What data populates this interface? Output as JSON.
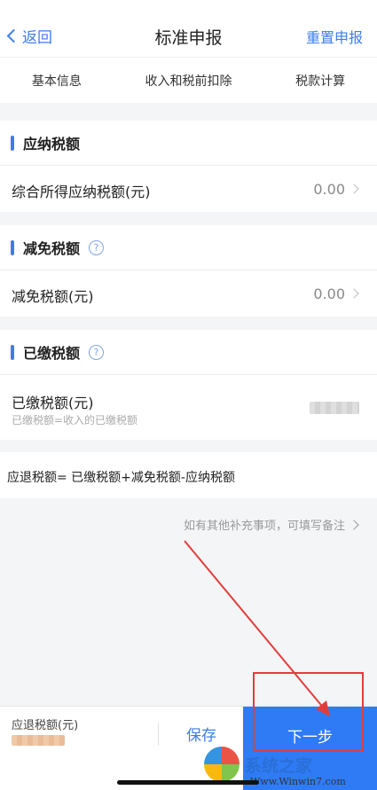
{
  "nav": {
    "back_label": "返回",
    "title": "标准申报",
    "reset_label": "重置申报"
  },
  "tabs": [
    "基本信息",
    "收入和税前扣除",
    "税款计算"
  ],
  "sections": {
    "payable": {
      "title": "应纳税额",
      "row_label": "综合所得应纳税额(元)",
      "row_value": "0.00"
    },
    "reduction": {
      "title": "减免税额",
      "row_label": "减免税额(元)",
      "row_value": "0.00"
    },
    "paid": {
      "title": "已缴税额",
      "row_label": "已缴税额(元)",
      "row_sub": "已缴税额=收入的已缴税额"
    }
  },
  "formula": "应退税额= 已缴税额+减免税额-应纳税额",
  "note": "如有其他补充事项，可填写备注",
  "footer": {
    "refund_label": "应退税额(元)",
    "save_label": "保存",
    "next_label": "下一步"
  },
  "watermark": {
    "brand": "系统之家",
    "url": "Www.Winwin7.com"
  },
  "colors": {
    "accent": "#3d7ee6",
    "primary_button": "#2f7bf5",
    "annotation": "#e23d3d"
  },
  "icons": {
    "back": "chevron-left-icon",
    "help": "question-circle-icon",
    "row_arrow": "chevron-right-icon"
  }
}
